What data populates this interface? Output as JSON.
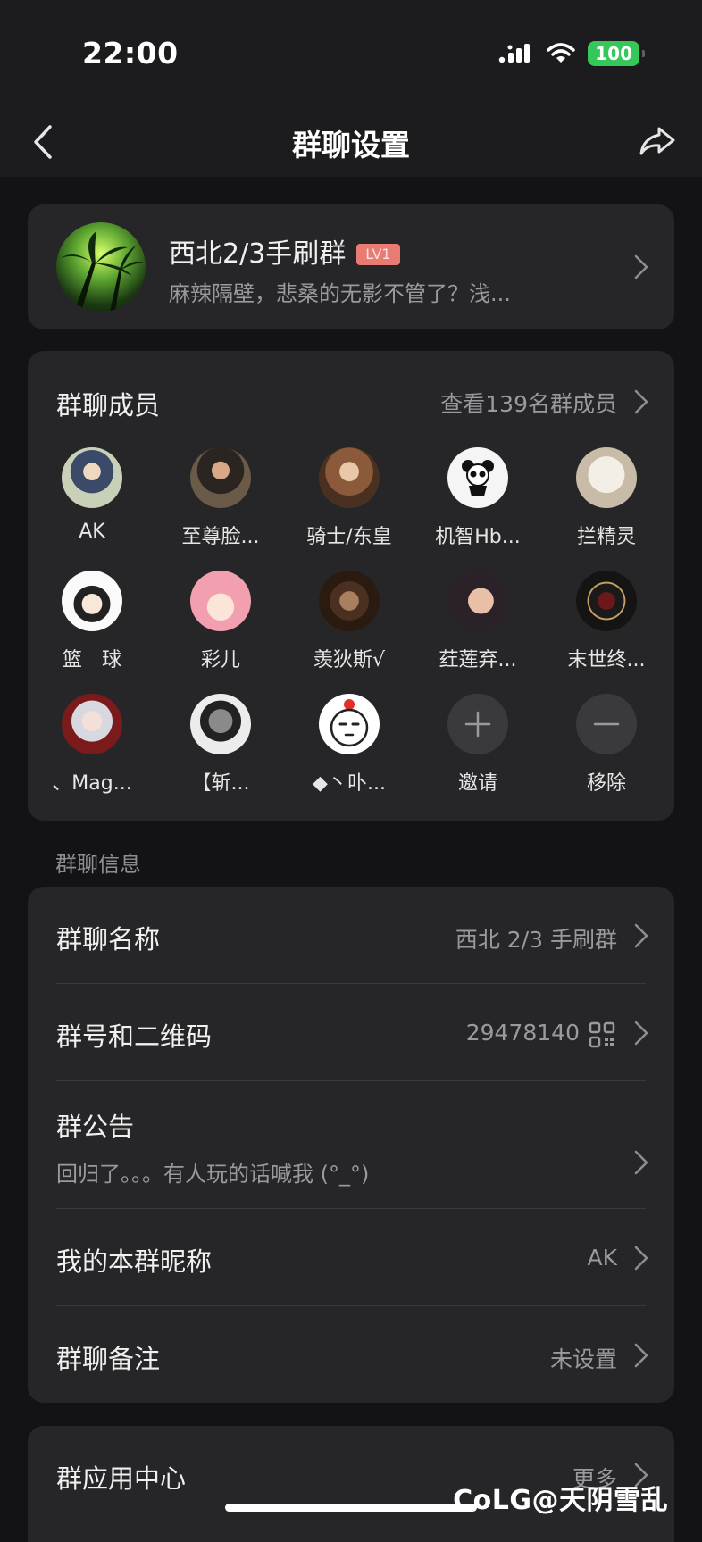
{
  "status_bar": {
    "time": "22:00",
    "battery": "100"
  },
  "nav": {
    "title": "群聊设置"
  },
  "group": {
    "name": "西北2/3手刷群",
    "level": "LV1",
    "latest_message": "麻辣隔壁，悲桑的无影不管了？浅..."
  },
  "members": {
    "title": "群聊成员",
    "view_all": "查看139名群成员",
    "items": [
      {
        "name": "AK"
      },
      {
        "name": "至尊脸..."
      },
      {
        "name": "骑士/东皇"
      },
      {
        "name": "机智Hb..."
      },
      {
        "name": "拦精灵"
      },
      {
        "name": "篮　球"
      },
      {
        "name": "彩儿"
      },
      {
        "name": "羡狄斯√"
      },
      {
        "name": "荭莲弃..."
      },
      {
        "name": "末世终..."
      },
      {
        "name": "、Mag..."
      },
      {
        "name": "【斩..."
      },
      {
        "name": "◆丶卟..."
      }
    ],
    "invite_label": "邀请",
    "remove_label": "移除"
  },
  "info": {
    "section_label": "群聊信息",
    "name_label": "群聊名称",
    "name_value": "西北 2/3 手刷群",
    "number_label": "群号和二维码",
    "number_value": "29478140",
    "announcement_label": "群公告",
    "announcement_value": "回归了。。。有人玩的话喊我 (°_°)",
    "nickname_label": "我的本群昵称",
    "nickname_value": "AK",
    "remark_label": "群聊备注",
    "remark_value": "未设置"
  },
  "apps": {
    "label": "群应用中心",
    "more": "更多"
  },
  "watermark": "CoLG@天阴雪乱",
  "colors": {
    "background": "#131315",
    "card": "#262628",
    "accent_badge": "#e97c72",
    "battery": "#35c759"
  }
}
